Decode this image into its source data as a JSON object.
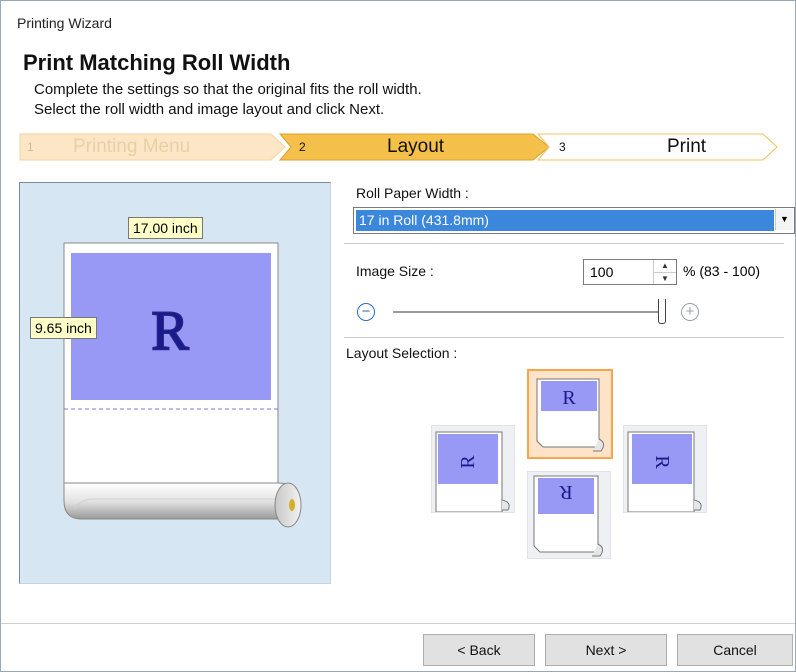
{
  "window": {
    "title": "Printing Wizard"
  },
  "header": {
    "heading": "Print Matching Roll Width",
    "line1": "Complete the settings so that the original fits the roll width.",
    "line2": "Select the roll width and image layout and click Next."
  },
  "steps": [
    {
      "num": "1",
      "label": "Printing Menu",
      "state": "done"
    },
    {
      "num": "2",
      "label": "Layout",
      "state": "current"
    },
    {
      "num": "3",
      "label": "Print",
      "state": "pending"
    }
  ],
  "preview": {
    "width_label": "17.00 inch",
    "height_label": "9.65 inch",
    "glyph": "R"
  },
  "roll": {
    "label": "Roll Paper Width :",
    "value": "17 in Roll (431.8mm)"
  },
  "image_size": {
    "label": "Image Size :",
    "value": "100",
    "range": "% (83 - 100)",
    "slider_fraction": 1.0
  },
  "layout": {
    "label": "Layout Selection :",
    "glyph": "R",
    "selected": "up"
  },
  "buttons": {
    "back": "< Back",
    "next": "Next >",
    "cancel": "Cancel"
  },
  "colors": {
    "accent": "#f5c04a",
    "image_fill": "#9898f5",
    "preview_bg": "#d6e6f2",
    "selection": "#3b87db"
  },
  "icons": {
    "zoom_out": "minus-circle-icon",
    "zoom_in": "plus-circle-icon",
    "dropdown": "chevron-down-icon",
    "spinner": "spin-arrows-icon"
  }
}
